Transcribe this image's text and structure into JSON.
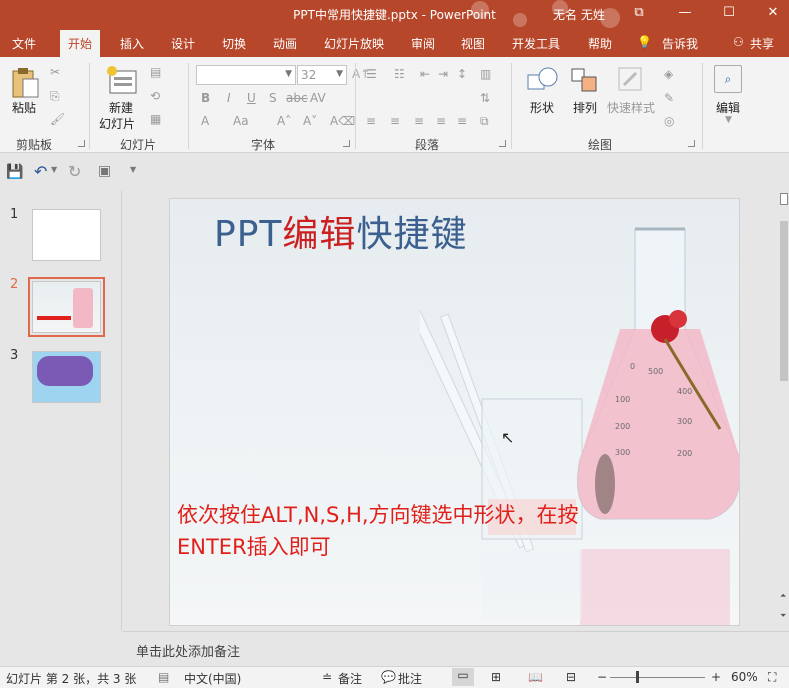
{
  "titlebar": {
    "doc_title": "PPT中常用快捷键.pptx - PowerPoint",
    "user": "无名 无姓",
    "restore_glyph": "⧉",
    "minimize_glyph": "—",
    "maximize_glyph": "☐",
    "close_glyph": "✕"
  },
  "tabs": {
    "file": "文件",
    "home": "开始",
    "insert": "插入",
    "design": "设计",
    "transitions": "切换",
    "animations": "动画",
    "slideshow": "幻灯片放映",
    "review": "审阅",
    "view": "视图",
    "developer": "开发工具",
    "help": "帮助",
    "tellme": "告诉我",
    "share": "共享"
  },
  "ribbon": {
    "paste": "粘贴",
    "clipboard_group": "剪贴板",
    "new_slide_line1": "新建",
    "new_slide_line2": "幻灯片",
    "slides_group": "幻灯片",
    "font_size": "32",
    "font_group": "字体",
    "paragraph_group": "段落",
    "shape": "形状",
    "arrange": "排列",
    "quick_styles": "快速样式",
    "drawing_group": "绘图",
    "editing": "编辑",
    "bold": "B",
    "italic": "I",
    "underline": "U",
    "shadow": "S",
    "strike": "abc",
    "spacing": "AV",
    "aa": "Aa",
    "a_plain": "A"
  },
  "thumbnails": [
    {
      "num": "1"
    },
    {
      "num": "2"
    },
    {
      "num": "3"
    }
  ],
  "slide": {
    "title_part1": "PPT",
    "title_part2": "编辑",
    "title_part3": "快捷键",
    "body": "依次按住ALT,N,S,H,方向键选中形状，在按ENTER插入即可",
    "flask_labels": [
      "500",
      "400",
      "300",
      "200",
      "100",
      "200",
      "300",
      "0"
    ]
  },
  "notes": {
    "placeholder": "单击此处添加备注"
  },
  "status": {
    "slide_info": "幻灯片 第 2 张，共 3 张",
    "language": "中文(中国)",
    "notes_btn": "备注",
    "comments_btn": "批注",
    "zoom": "60%"
  },
  "colors": {
    "accent": "#b7472a",
    "title_blue": "#3b5f8e",
    "title_red": "#cc1f1f",
    "body_red": "#e0201a",
    "selected_thumb": "#e0684b"
  }
}
